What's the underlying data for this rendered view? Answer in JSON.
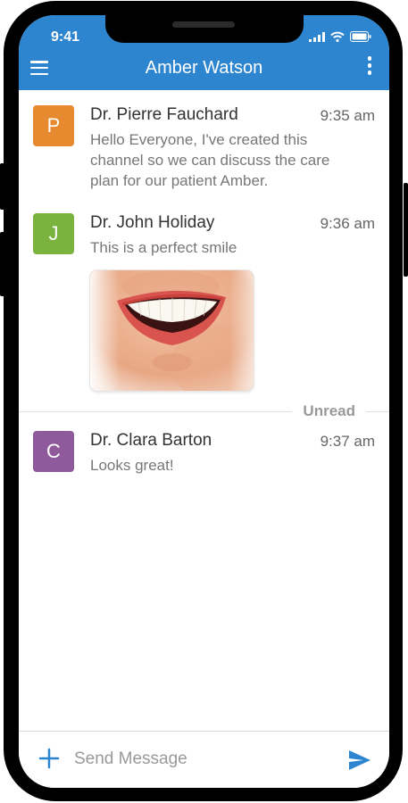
{
  "status_bar": {
    "time": "9:41"
  },
  "header": {
    "title": "Amber Watson"
  },
  "messages": [
    {
      "initial": "P",
      "sender": "Dr. Pierre Fauchard",
      "time": "9:35 am",
      "text": "Hello Everyone, I've created this channel so we can discuss the care plan for our patient Amber.",
      "avatar_color": "#e6892f"
    },
    {
      "initial": "J",
      "sender": "Dr. John Holiday",
      "time": "9:36 am",
      "text": "This is a perfect smile",
      "avatar_color": "#7ab33e"
    },
    {
      "initial": "C",
      "sender": "Dr. Clara Barton",
      "time": "9:37 am",
      "text": "Looks great!",
      "avatar_color": "#8e5a9b"
    }
  ],
  "unread_label": "Unread",
  "composer": {
    "placeholder": "Send Message"
  },
  "colors": {
    "accent": "#2e85cf"
  },
  "icons": {
    "menu": "hamburger-menu-icon",
    "more": "vertical-dots-icon",
    "add": "plus-icon",
    "send": "paper-plane-send-icon"
  }
}
